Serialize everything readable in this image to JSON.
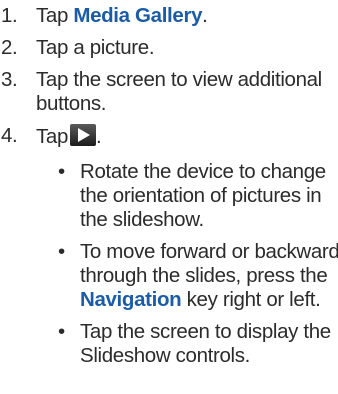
{
  "steps": [
    {
      "num": "1.",
      "pre": "Tap ",
      "bold": "Media Gallery",
      "post": "."
    },
    {
      "num": "2.",
      "text": "Tap a picture."
    },
    {
      "num": "3.",
      "line1": "Tap the screen to view additional",
      "line2": "buttons."
    },
    {
      "num": "4.",
      "pre": "Tap",
      "post": ".",
      "icon": "play-icon"
    }
  ],
  "bullets": [
    {
      "line1": "Rotate the device to change",
      "line2": "the orientation of pictures in",
      "line3": "the slideshow."
    },
    {
      "line1": "To move forward or backward",
      "line2": "through the slides, press the",
      "bold": "Navigation",
      "line3_post": " key right or left."
    },
    {
      "line1": "Tap the screen to display the",
      "line2": "Slideshow controls."
    }
  ],
  "bullet_char": "•",
  "colors": {
    "text": "#2b2b2b",
    "accent": "#1a5ca8"
  }
}
